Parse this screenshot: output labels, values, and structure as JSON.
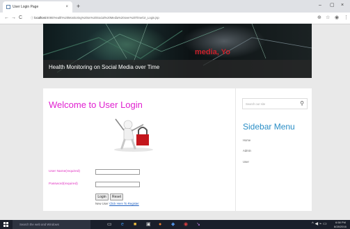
{
  "browser": {
    "tab_title": "User Login Page",
    "tab_close": "×",
    "new_tab": "+",
    "window_controls": [
      "–",
      "▢",
      "×"
    ],
    "url_host": "localhost",
    "url_path": ":8080/Health%20Monitoring%20on%20Social%20Media%20over%20Time/UI_Login.jsp",
    "nav": [
      "←",
      "→",
      "C"
    ]
  },
  "banner": {
    "partial_text": "media, Yo",
    "title": "Health Monitoring on Social Media over Time"
  },
  "login": {
    "heading": "Welcome to User Login",
    "username_label": "User Name(required)",
    "password_label": "Password(required)",
    "username_value": "",
    "password_value": "",
    "login_button": "Login",
    "reset_button": "Reset",
    "register_prefix": "New User",
    "register_link": "Click Here To Register"
  },
  "sidebar": {
    "search_placeholder": "Search our site",
    "title": "Sidebar Menu",
    "items": [
      "Home",
      "Admin",
      "User"
    ]
  },
  "taskbar": {
    "search_text": "Search the web and Windows",
    "time": "6:58 PM",
    "date": "8/28/2016"
  },
  "colors": {
    "heading": "#e020d0",
    "labels": "#e030c0",
    "sidebar_title": "#2a8ec6",
    "link": "#2060c0"
  }
}
